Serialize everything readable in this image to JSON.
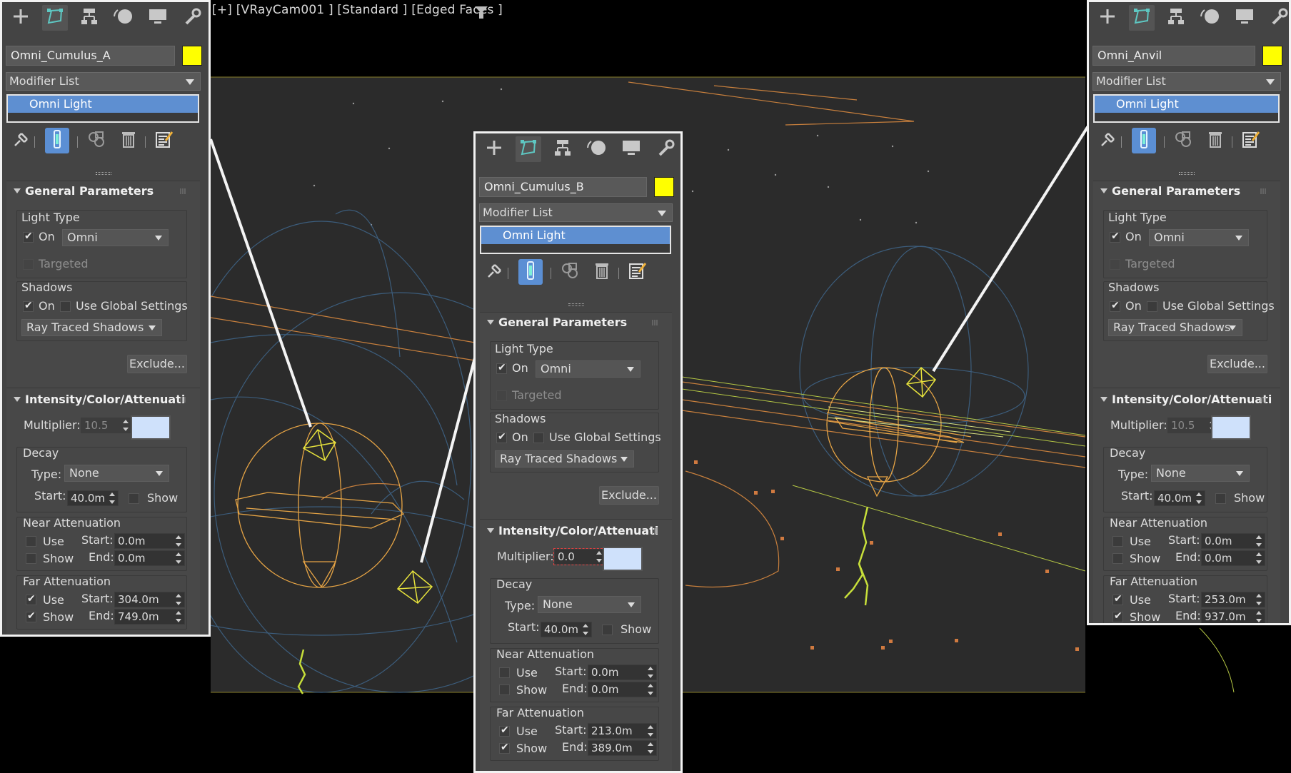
{
  "viewport": {
    "label": "[+] [VRayCam001 ] [Standard ] [Edged Faces ]"
  },
  "panels": [
    {
      "name": "Omni_Cumulus_A",
      "modifier_list": "Modifier List",
      "stack_item": "Omni Light",
      "general_title": "General Parameters",
      "light_type_label": "Light Type",
      "light_on_label": "On",
      "light_type_value": "Omni",
      "targeted_label": "Targeted",
      "shadows_label": "Shadows",
      "shadows_on_label": "On",
      "use_global_label": "Use Global Settings",
      "shadow_type": "Ray Traced Shadows",
      "exclude_label": "Exclude...",
      "intensity_title": "Intensity/Color/Attenuati",
      "multiplier_label": "Multiplier:",
      "multiplier_value": "10.5",
      "decay_label": "Decay",
      "type_label": "Type:",
      "decay_type": "None",
      "start_label": "Start:",
      "decay_start": "40.0m",
      "show_label": "Show",
      "near_label": "Near Attenuation",
      "use_label": "Use",
      "end_label": "End:",
      "near_start": "0.0m",
      "near_end": "0.0m",
      "far_label": "Far Attenuation",
      "far_start": "304.0m",
      "far_end": "749.0m"
    },
    {
      "name": "Omni_Cumulus_B",
      "modifier_list": "Modifier List",
      "stack_item": "Omni Light",
      "general_title": "General Parameters",
      "light_type_label": "Light Type",
      "light_on_label": "On",
      "light_type_value": "Omni",
      "targeted_label": "Targeted",
      "shadows_label": "Shadows",
      "shadows_on_label": "On",
      "use_global_label": "Use Global Settings",
      "shadow_type": "Ray Traced Shadows",
      "exclude_label": "Exclude...",
      "intensity_title": "Intensity/Color/Attenuati",
      "multiplier_label": "Multiplier:",
      "multiplier_value": "0.0",
      "decay_label": "Decay",
      "type_label": "Type:",
      "decay_type": "None",
      "start_label": "Start:",
      "decay_start": "40.0m",
      "show_label": "Show",
      "near_label": "Near Attenuation",
      "use_label": "Use",
      "end_label": "End:",
      "near_start": "0.0m",
      "near_end": "0.0m",
      "far_label": "Far Attenuation",
      "far_start": "213.0m",
      "far_end": "389.0m"
    },
    {
      "name": "Omni_Anvil",
      "modifier_list": "Modifier List",
      "stack_item": "Omni Light",
      "general_title": "General Parameters",
      "light_type_label": "Light Type",
      "light_on_label": "On",
      "light_type_value": "Omni",
      "targeted_label": "Targeted",
      "shadows_label": "Shadows",
      "shadows_on_label": "On",
      "use_global_label": "Use Global Settings",
      "shadow_type": "Ray Traced Shadows",
      "exclude_label": "Exclude...",
      "intensity_title": "Intensity/Color/Attenuati",
      "multiplier_label": "Multiplier:",
      "multiplier_value": "10.5",
      "decay_label": "Decay",
      "type_label": "Type:",
      "decay_type": "None",
      "start_label": "Start:",
      "decay_start": "40.0m",
      "show_label": "Show",
      "near_label": "Near Attenuation",
      "use_label": "Use",
      "end_label": "End:",
      "near_start": "0.0m",
      "near_end": "0.0m",
      "far_label": "Far Attenuation",
      "far_start": "253.0m",
      "far_end": "937.0m"
    }
  ],
  "icons": {
    "create": "plus-icon",
    "modify": "modify-icon",
    "hierarchy": "hierarchy-icon",
    "motion": "motion-icon",
    "display": "display-icon",
    "utilities": "wrench-icon",
    "pin": "pin-stack-icon",
    "show_end": "show-end-result-icon",
    "make_unique": "make-unique-icon",
    "remove": "trash-icon",
    "configure": "configure-modifier-sets-icon"
  },
  "colors": {
    "object_color": "#ffff00",
    "light_color": "#cfe1fb",
    "selection": "#5e8fd1",
    "viewport_bg": "#2b2b2b"
  }
}
